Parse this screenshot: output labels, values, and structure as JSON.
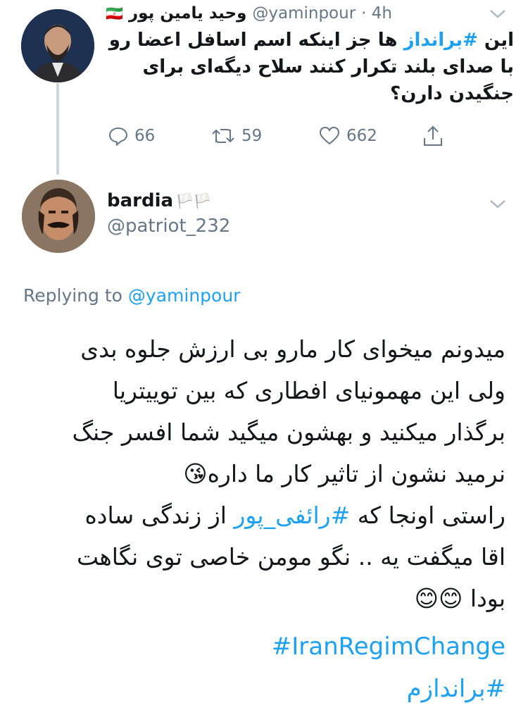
{
  "parent_tweet": {
    "display_name": "وحید یامین پور",
    "flag": "🇮🇷",
    "handle": "@yaminpour",
    "time": "· 4h",
    "text_prefix": "این ",
    "hashtag": "#برانداز",
    "text_rest": " ها جز اینکه اسم اسافل اعضا رو با صدای بلند تکرار کنند سلاح دیگه‌ای برای جنگیدن دارن؟",
    "reply_count": "66",
    "retweet_count": "59",
    "like_count": "662",
    "icons": {
      "reply": "reply-icon",
      "retweet": "retweet-icon",
      "like": "heart-icon",
      "share": "share-icon",
      "more": "chevron-down-icon"
    }
  },
  "reply_tweet": {
    "display_name": "bardia",
    "flags": "🏳️🏳️",
    "handle": "@patriot_232",
    "replying_label": "Replying to",
    "replying_handle": "@yaminpour",
    "lines": [
      "میدونم میخوای کار مارو بی ارزش جلوه بدی",
      "ولی این مهمونیای افطاری که بین توییتریا",
      "برگذار میکنید و بهشون میگید شما افسر جنگ",
      "نرمید نشون از تاثیر کار ما داره😘"
    ],
    "line5_prefix": "راستی اونجا که ",
    "line5_hashtag": "#رائفی_پور",
    "line5_suffix": " از زندگی ساده",
    "line6": "اقا میگفت یه .. نگو مومن خاصی توی نگاهت",
    "line7": "بودا 😊😊",
    "hashtag1": "#IranRegimChange",
    "hashtag2": "#براندازم"
  },
  "colors": {
    "link": "#1da1f2",
    "meta": "#657786",
    "line": "#ccd6dd"
  }
}
